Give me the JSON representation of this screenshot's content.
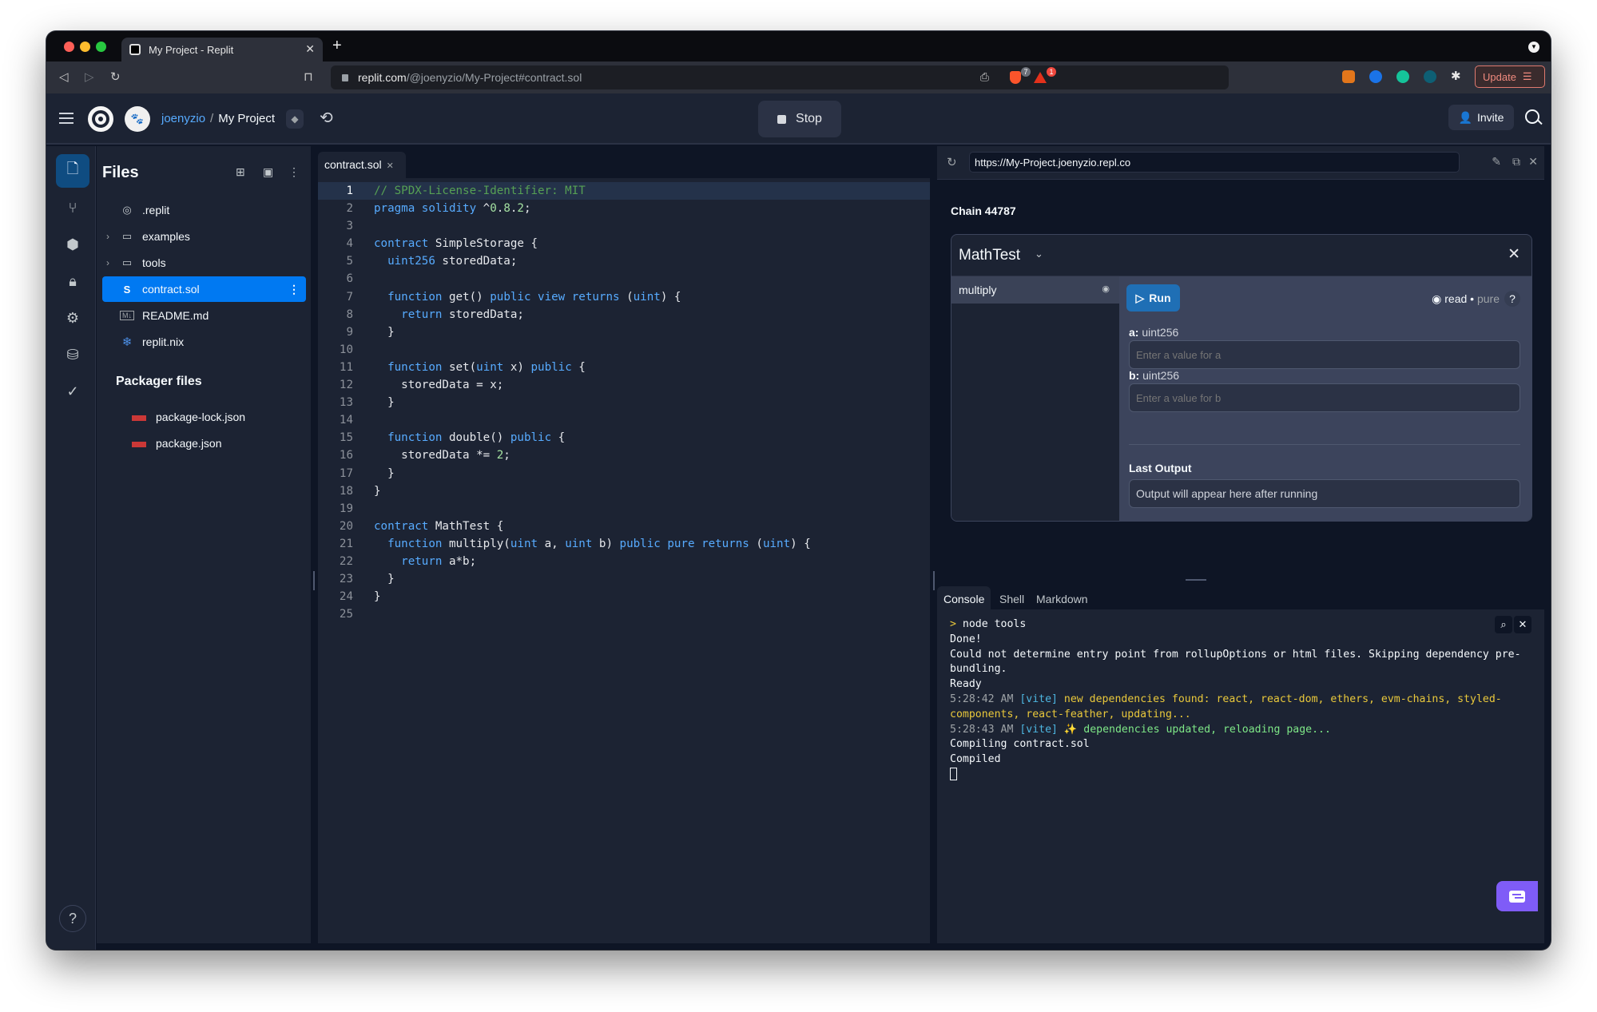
{
  "browser": {
    "tab_title": "My Project - Replit",
    "new_tab": "+",
    "url_host": "replit.com",
    "url_path": "/@joenyzio/My-Project#contract.sol",
    "brave_shield_count": "7",
    "rewards_count": "1",
    "update_label": "Update"
  },
  "header": {
    "username": "joenyzio",
    "separator": "/",
    "project": "My Project",
    "stop_label": "Stop",
    "invite_label": "Invite"
  },
  "files": {
    "title": "Files",
    "items": [
      {
        "name": ".replit",
        "icon": "replit-icon"
      },
      {
        "name": "examples",
        "icon": "folder-icon",
        "folder": true
      },
      {
        "name": "tools",
        "icon": "folder-icon",
        "folder": true
      },
      {
        "name": "contract.sol",
        "icon": "solidity-icon",
        "selected": true
      },
      {
        "name": "README.md",
        "icon": "markdown-icon"
      },
      {
        "name": "replit.nix",
        "icon": "nix-icon"
      }
    ],
    "packager_title": "Packager files",
    "packager_items": [
      "package-lock.json",
      "package.json"
    ]
  },
  "editor": {
    "tab": "contract.sol",
    "current_line": 1,
    "lines": [
      "// SPDX-License-Identifier: MIT",
      "pragma solidity ^0.8.2;",
      "",
      "contract SimpleStorage {",
      "  uint256 storedData;",
      "",
      "  function get() public view returns (uint) {",
      "    return storedData;",
      "  }",
      "",
      "  function set(uint x) public {",
      "    storedData = x;",
      "  }",
      "",
      "  function double() public {",
      "    storedData *= 2;",
      "  }",
      "}",
      "",
      "contract MathTest {",
      "  function multiply(uint a, uint b) public pure returns (uint) {",
      "    return a*b;",
      "  }",
      "}",
      ""
    ]
  },
  "webview": {
    "url": "https://My-Project.joenyzio.repl.co",
    "chain": "Chain 44787",
    "contract_name": "MathTest",
    "function_name": "multiply",
    "run_label": "Run",
    "mode_read": "read",
    "mode_sep": " • ",
    "mode_pure": "pure",
    "help": "?",
    "params": [
      {
        "name": "a:",
        "type": "uint256",
        "placeholder": "Enter a value for a"
      },
      {
        "name": "b:",
        "type": "uint256",
        "placeholder": "Enter a value for b"
      }
    ],
    "output_label": "Last Output",
    "output_text": "Output will appear here after running"
  },
  "console": {
    "tabs": [
      "Console",
      "Shell",
      "Markdown"
    ],
    "active_tab": "Console",
    "prompt": "> ",
    "command": "node tools",
    "lines": [
      {
        "text": "Done!"
      },
      {
        "text": "Could not determine entry point from rollupOptions or html files. Skipping dependency pre-bundling."
      },
      {
        "text": "Ready"
      },
      {
        "ts": "5:28:42 AM",
        "tag": "[vite]",
        "msg": "new dependencies found: react, react-dom, ethers, evm-chains, styled-components, react-feather, updating...",
        "color": "yellow"
      },
      {
        "ts": "5:28:43 AM",
        "tag": "[vite]",
        "msg": "✨ dependencies updated, reloading page...",
        "color": "green"
      },
      {
        "text": "Compiling contract.sol"
      },
      {
        "text": "Compiled"
      }
    ]
  },
  "colors": {
    "accent": "#0079f2",
    "run_button": "#1f6fb5",
    "chat_button": "#7f5cf7",
    "update_border": "#e07a6f"
  }
}
